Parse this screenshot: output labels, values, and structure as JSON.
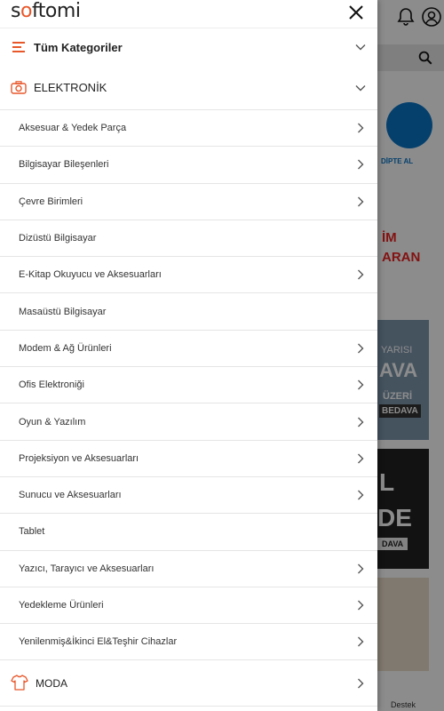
{
  "logo": {
    "text_a": "s",
    "text_o": "o",
    "text_b": "ftomi"
  },
  "menu": {
    "all_categories_label": "Tüm Kategoriler",
    "section_label": "ELEKTRONİK",
    "items": [
      {
        "label": "Aksesuar & Yedek Parça",
        "has_children": true
      },
      {
        "label": "Bilgisayar Bileşenleri",
        "has_children": true
      },
      {
        "label": "Çevre Birimleri",
        "has_children": true
      },
      {
        "label": "Dizüstü Bilgisayar",
        "has_children": false
      },
      {
        "label": "E-Kitap Okuyucu ve Aksesuarları",
        "has_children": true
      },
      {
        "label": "Masaüstü Bilgisayar",
        "has_children": false
      },
      {
        "label": "Modem & Ağ Ürünleri",
        "has_children": true
      },
      {
        "label": "Ofis Elektroniği",
        "has_children": true
      },
      {
        "label": "Oyun & Yazılım",
        "has_children": true
      },
      {
        "label": "Projeksiyon ve Aksesuarları",
        "has_children": true
      },
      {
        "label": "Sunucu ve Aksesuarları",
        "has_children": true
      },
      {
        "label": "Tablet",
        "has_children": false
      },
      {
        "label": "Yazıcı, Tarayıcı ve Aksesuarları",
        "has_children": true
      },
      {
        "label": "Yedekleme Ürünleri",
        "has_children": true
      },
      {
        "label": "Yenilenmiş&İkinci El&Teşhir Cihazlar",
        "has_children": true
      }
    ],
    "next_section_label": "MODA"
  },
  "background": {
    "promo_logo_text": "DİPTE AL",
    "promo_text_1": "İM",
    "promo_text_2": "ARAN",
    "banner1_line1": "YARISI",
    "banner1_line2": "AVA",
    "banner1_line3": "ÜZERİ",
    "banner1_line4": "BEDAVA",
    "banner2_line1": "L",
    "banner2_line2": "DE",
    "banner2_line3": "DAVA",
    "support_label": "Destek"
  },
  "colors": {
    "accent": "#e8572a",
    "overlay": "rgba(0,0,0,0.45)"
  },
  "icons": [
    "close-icon",
    "list-icon",
    "camera-icon",
    "shirt-icon",
    "chevron-down-icon",
    "chevron-right-icon",
    "bell-icon",
    "user-icon",
    "search-icon"
  ]
}
